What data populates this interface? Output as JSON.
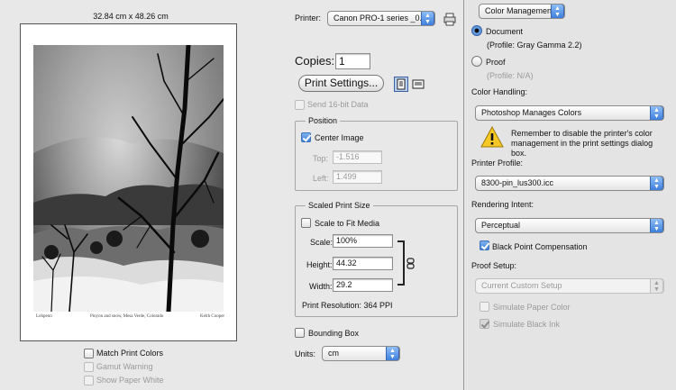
{
  "preview": {
    "size_label": "32.84 cm x 48.26 cm",
    "caption": "Pinyon and snow, Mesa Verde, Colorado",
    "caption_left": "Lohpenn",
    "caption_right": "Keith Cooper"
  },
  "preview_options": {
    "match_print_colors": "Match Print Colors",
    "gamut_warning": "Gamut Warning",
    "show_paper_white": "Show Paper White"
  },
  "printer": {
    "label": "Printer:",
    "value": "Canon PRO-1 series _0..."
  },
  "copies": {
    "label": "Copies:",
    "value": "1"
  },
  "print_settings_label": "Print Settings...",
  "send_16bit_label": "Send 16-bit Data",
  "position": {
    "title": "Position",
    "center_image": "Center Image",
    "top_label": "Top:",
    "top_value": "-1.516",
    "left_label": "Left:",
    "left_value": "1.499"
  },
  "scaled": {
    "title": "Scaled Print Size",
    "scale_to_fit": "Scale to Fit Media",
    "scale_label": "Scale:",
    "scale_value": "100%",
    "height_label": "Height:",
    "height_value": "44.32",
    "width_label": "Width:",
    "width_value": "29.2",
    "resolution": "Print Resolution: 364 PPI"
  },
  "bounding_box_label": "Bounding Box",
  "units": {
    "label": "Units:",
    "value": "cm"
  },
  "color_mgmt": {
    "section": "Color Management",
    "document_label": "Document",
    "document_profile": "(Profile: Gray Gamma 2.2)",
    "proof_label": "Proof",
    "proof_profile": "(Profile: N/A)",
    "color_handling_label": "Color Handling:",
    "color_handling_value": "Photoshop Manages Colors",
    "warning_text": "Remember to disable the printer's color management in the print settings dialog box.",
    "printer_profile_label": "Printer Profile:",
    "printer_profile_value": "8300-pin_lus300.icc",
    "rendering_intent_label": "Rendering Intent:",
    "rendering_intent_value": "Perceptual",
    "black_point_label": "Black Point Compensation",
    "proof_setup_label": "Proof Setup:",
    "proof_setup_value": "Current Custom Setup",
    "simulate_paper_label": "Simulate Paper Color",
    "simulate_ink_label": "Simulate Black Ink"
  }
}
